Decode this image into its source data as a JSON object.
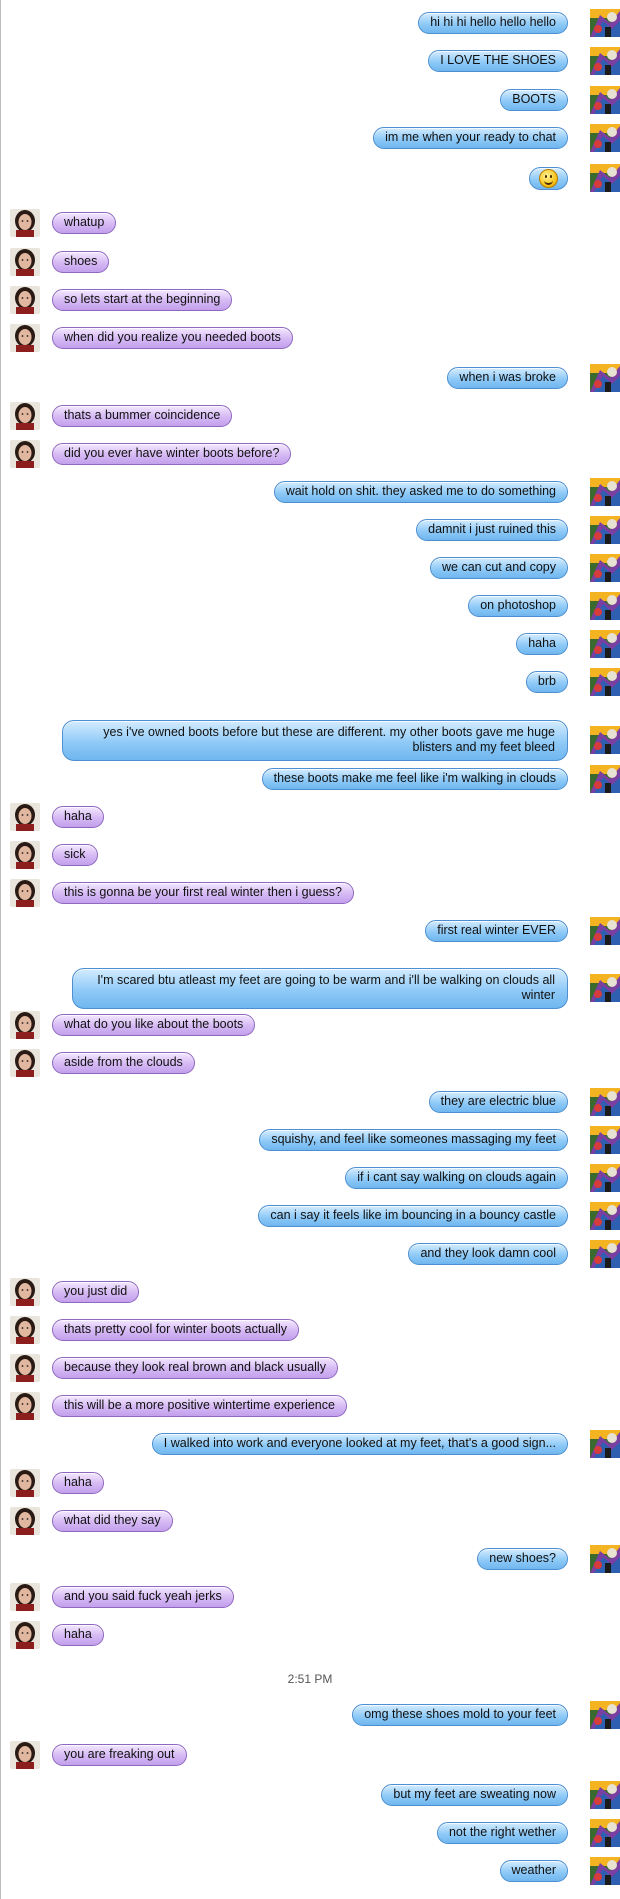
{
  "conversation": {
    "timestamp": "2:51 PM",
    "icons": {
      "self_avatar": "colorful-cartoon-avatar",
      "other_avatar": "woman-portrait-avatar",
      "emoji": "smiley-face"
    },
    "messages": [
      {
        "from": "me",
        "text": "hi hi hi hello hello hello"
      },
      {
        "from": "me",
        "text": "I LOVE THE SHOES"
      },
      {
        "from": "me",
        "text": "BOOTS"
      },
      {
        "from": "me",
        "text": "im me when your ready to chat"
      },
      {
        "from": "me",
        "text": "",
        "emoji": true
      },
      {
        "from": "them",
        "text": "whatup"
      },
      {
        "from": "them",
        "text": "shoes"
      },
      {
        "from": "them",
        "text": "so lets start at the beginning"
      },
      {
        "from": "them",
        "text": "when did you realize you needed boots"
      },
      {
        "from": "me",
        "text": "when i was broke"
      },
      {
        "from": "them",
        "text": "thats a bummer coincidence"
      },
      {
        "from": "them",
        "text": "did you ever have winter boots before?"
      },
      {
        "from": "me",
        "text": "wait hold on shit. they asked me to do something"
      },
      {
        "from": "me",
        "text": "damnit i just ruined this"
      },
      {
        "from": "me",
        "text": "we can cut and copy"
      },
      {
        "from": "me",
        "text": "on  photoshop"
      },
      {
        "from": "me",
        "text": "haha"
      },
      {
        "from": "me",
        "text": "brb"
      },
      {
        "from": "me",
        "text": "yes i've owned boots before but these are different. my other boots gave me huge blisters and my feet bleed",
        "wide": true
      },
      {
        "from": "me",
        "text": "these boots make me feel like i'm walking in clouds"
      },
      {
        "from": "them",
        "text": "haha"
      },
      {
        "from": "them",
        "text": "sick"
      },
      {
        "from": "them",
        "text": "this is gonna be your first real winter then i guess?"
      },
      {
        "from": "me",
        "text": "first real winter EVER"
      },
      {
        "from": "me",
        "text": "I'm scared btu atleast my feet are going to be warm and i'll be walking on clouds all winter",
        "wide": true
      },
      {
        "from": "them",
        "text": "what do you like about the boots"
      },
      {
        "from": "them",
        "text": "aside from the clouds"
      },
      {
        "from": "me",
        "text": "they are electric blue"
      },
      {
        "from": "me",
        "text": "squishy, and feel like someones massaging my feet"
      },
      {
        "from": "me",
        "text": "if i cant say walking on clouds again"
      },
      {
        "from": "me",
        "text": "can i say it feels like im bouncing in a bouncy castle"
      },
      {
        "from": "me",
        "text": "and they look damn cool"
      },
      {
        "from": "them",
        "text": "you just did"
      },
      {
        "from": "them",
        "text": "thats pretty cool for winter boots actually"
      },
      {
        "from": "them",
        "text": "because they look real brown and black usually"
      },
      {
        "from": "them",
        "text": "this will be a more positive wintertime experience"
      },
      {
        "from": "me",
        "text": "I walked into work and everyone looked at my feet, that's a good sign..."
      },
      {
        "from": "them",
        "text": "haha"
      },
      {
        "from": "them",
        "text": "what did they say"
      },
      {
        "from": "me",
        "text": "new shoes?"
      },
      {
        "from": "them",
        "text": "and you said fuck yeah jerks"
      },
      {
        "from": "them",
        "text": "haha"
      },
      {
        "from": "me",
        "text": "omg these shoes mold to your feet"
      },
      {
        "from": "them",
        "text": "you are freaking out"
      },
      {
        "from": "me",
        "text": "but my feet are sweating now"
      },
      {
        "from": "me",
        "text": "not the right wether"
      },
      {
        "from": "me",
        "text": "weather"
      }
    ]
  }
}
